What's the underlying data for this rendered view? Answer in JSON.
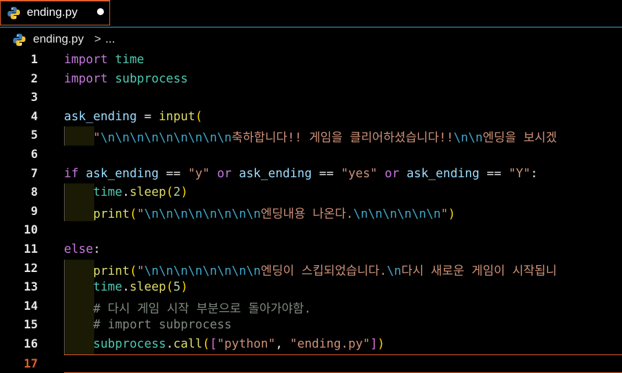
{
  "tab": {
    "label": "ending.py",
    "modified_dot": true
  },
  "breadcrumb": {
    "file": "ending.py",
    "separator": ">",
    "more": "..."
  },
  "lines": [
    {
      "n": "1",
      "text": "import time"
    },
    {
      "n": "2",
      "text": "import subprocess"
    },
    {
      "n": "3",
      "text": ""
    },
    {
      "n": "4",
      "text": "ask_ending = input("
    },
    {
      "n": "5",
      "text": "    \"\\n\\n\\n\\n\\n\\n\\n\\n\\n축하합니다!! 게임을 클리어하셨습니다!!\\n\\n엔딩을 보시겠"
    },
    {
      "n": "6",
      "text": ""
    },
    {
      "n": "7",
      "text": "if ask_ending == \"y\" or ask_ending == \"yes\" or ask_ending == \"Y\":"
    },
    {
      "n": "8",
      "text": "    time.sleep(2)"
    },
    {
      "n": "9",
      "text": "    print(\"\\n\\n\\n\\n\\n\\n\\n\\n엔딩내용 나온다.\\n\\n\\n\\n\\n\\n\")"
    },
    {
      "n": "10",
      "text": ""
    },
    {
      "n": "11",
      "text": "else:"
    },
    {
      "n": "12",
      "text": "    print(\"\\n\\n\\n\\n\\n\\n\\n\\n엔딩이 스킵되었습니다.\\n다시 새로운 게임이 시작됩니"
    },
    {
      "n": "13",
      "text": "    time.sleep(5)"
    },
    {
      "n": "14",
      "text": "    # 다시 게임 시작 부분으로 돌아가야함."
    },
    {
      "n": "15",
      "text": "    # import subprocess"
    },
    {
      "n": "16",
      "text": "    subprocess.call([\"python\", \"ending.py\"])"
    },
    {
      "n": "17",
      "text": ""
    }
  ],
  "current_line": "17"
}
